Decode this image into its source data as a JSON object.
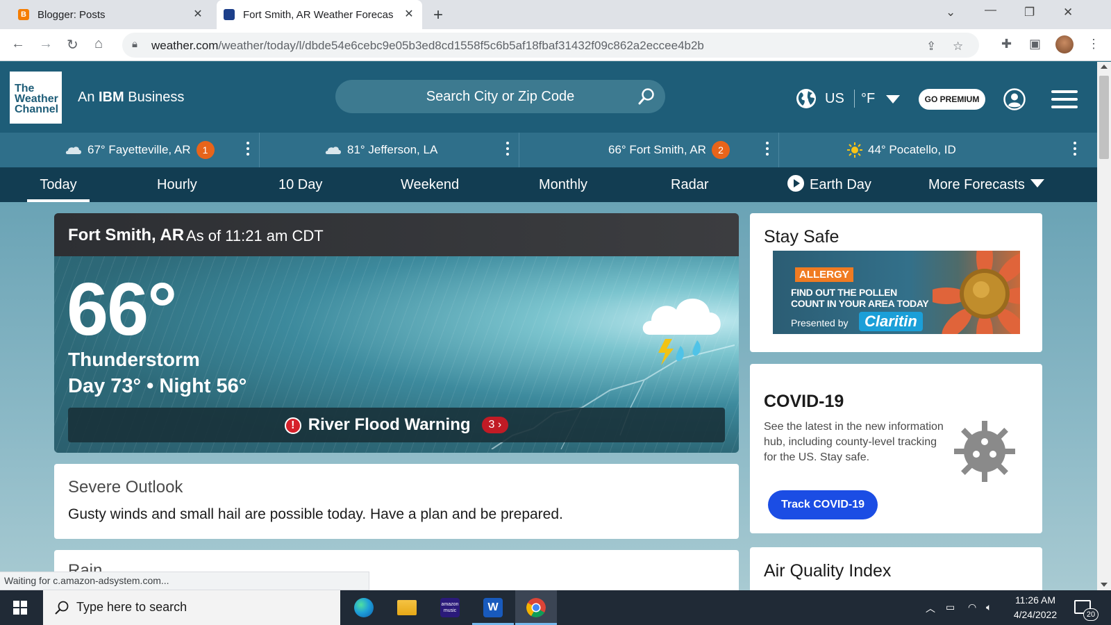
{
  "browser": {
    "tabs": [
      {
        "title": "Blogger: Posts",
        "favicon": "blogger-icon"
      },
      {
        "title": "Fort Smith, AR Weather Forecast",
        "favicon": "weather-channel-icon"
      }
    ],
    "url_host": "weather.com",
    "url_path": "/weather/today/l/dbde54e6cebc9e05b3ed8cd1558f5c6b5af18fbaf31432f09c862a2eccee4b2b",
    "status": "Waiting for c.amazon-adsystem.com..."
  },
  "site": {
    "logo_lines": [
      "The",
      "Weather",
      "Channel"
    ],
    "tagline_prefix": "An",
    "tagline_bold": "IBM",
    "tagline_suffix": "Business",
    "search_placeholder": "Search City or Zip Code",
    "region": "US",
    "unit": "°F",
    "premium_label": "GO PREMIUM"
  },
  "recents": [
    {
      "temp_loc": "67° Fayetteville, AR",
      "badge": "1",
      "icon": "cloud-icon"
    },
    {
      "temp_loc": "81° Jefferson, LA",
      "badge": "",
      "icon": "cloud-icon"
    },
    {
      "temp_loc": "66° Fort Smith, AR",
      "badge": "2",
      "icon": ""
    },
    {
      "temp_loc": "44° Pocatello, ID",
      "badge": "",
      "icon": "sun-icon"
    }
  ],
  "nav": [
    "Today",
    "Hourly",
    "10 Day",
    "Weekend",
    "Monthly",
    "Radar",
    "Earth Day",
    "More Forecasts"
  ],
  "current": {
    "location": "Fort Smith, AR",
    "as_of": "As of 11:21 am CDT",
    "temp": "66°",
    "phrase": "Thunderstorm",
    "day_night": "Day 73° • Night 56°",
    "alert": "River Flood Warning",
    "alert_count": "3"
  },
  "severe": {
    "title": "Severe Outlook",
    "text": "Gusty winds and small hail are possible today. Have a plan and be prepared."
  },
  "rain": {
    "title": "Rain"
  },
  "stay_safe": {
    "title": "Stay Safe",
    "ad_tag": "ALLERGY",
    "ad_line1": "FIND OUT THE POLLEN",
    "ad_line2": "COUNT IN YOUR AREA TODAY",
    "ad_presented": "Presented by",
    "ad_brand": "Claritin"
  },
  "covid": {
    "title": "COVID-19",
    "text": "See the latest in the new information hub, including county-level tracking for the US. Stay safe.",
    "button": "Track COVID-19"
  },
  "aqi": {
    "title": "Air Quality Index"
  },
  "taskbar": {
    "search_placeholder": "Type here to search",
    "time": "11:26 AM",
    "date": "4/24/2022",
    "notifications": "20",
    "amazon_label_1": "amazon",
    "amazon_label_2": "music",
    "word_label": "W"
  },
  "colors": {
    "header": "#1e5d78",
    "nav": "#123d52",
    "badge": "#e8641a",
    "covid_button": "#1b4de4",
    "alert_red": "#c11b25"
  }
}
